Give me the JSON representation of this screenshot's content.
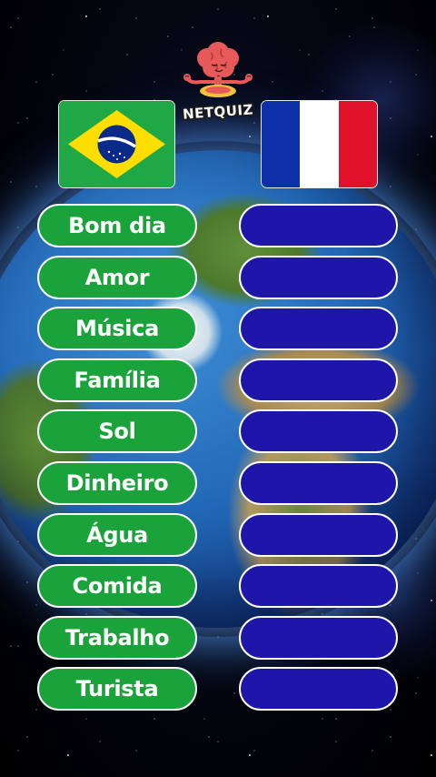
{
  "colors": {
    "left_pill": "#1aa33a",
    "right_pill": "#1d16a8",
    "pill_border": "#ffffff",
    "brazil_green": "#1fa845",
    "brazil_yellow": "#fedd00",
    "brazil_blue": "#0a2a8a",
    "france_blue": "#0d2fa8",
    "france_white": "#ffffff",
    "france_red": "#e0112b",
    "logo_brain": "#e85a5a"
  },
  "logo": {
    "text": "NETQUIZ",
    "icon": "meditating-brain-icon"
  },
  "flags": {
    "left": "brazil-flag-icon",
    "right": "france-flag-icon"
  },
  "words": [
    {
      "pt": "Bom dia",
      "fr": ""
    },
    {
      "pt": "Amor",
      "fr": ""
    },
    {
      "pt": "Música",
      "fr": ""
    },
    {
      "pt": "Família",
      "fr": ""
    },
    {
      "pt": "Sol",
      "fr": ""
    },
    {
      "pt": "Dinheiro",
      "fr": ""
    },
    {
      "pt": "Água",
      "fr": ""
    },
    {
      "pt": "Comida",
      "fr": ""
    },
    {
      "pt": "Trabalho",
      "fr": ""
    },
    {
      "pt": "Turista",
      "fr": ""
    }
  ]
}
